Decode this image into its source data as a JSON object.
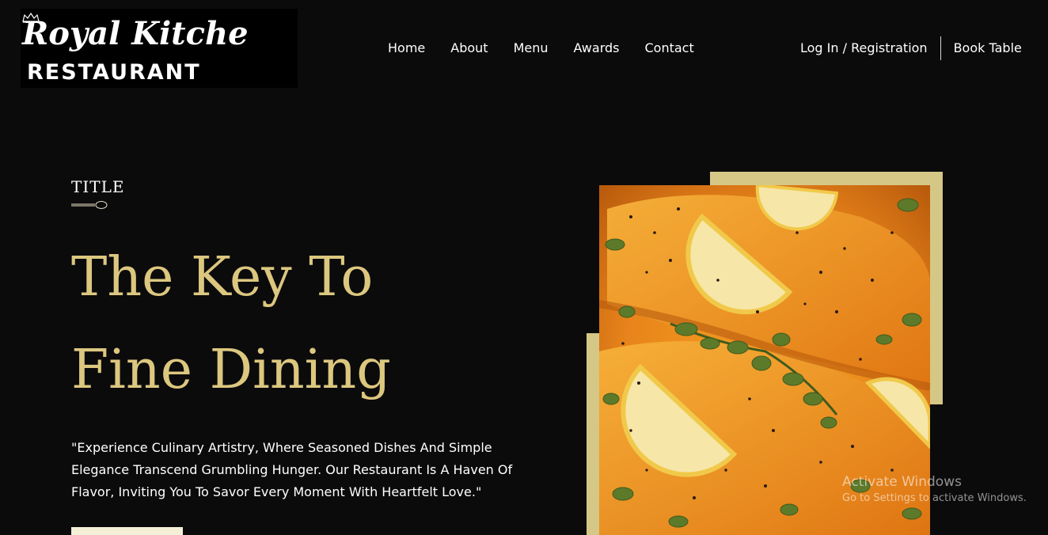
{
  "brand": {
    "line1": "Royal Kitche",
    "line2": "RESTAURANT"
  },
  "nav": {
    "items": [
      "Home",
      "About",
      "Menu",
      "Awards",
      "Contact"
    ]
  },
  "auth": {
    "login_label": "Log In / Registration",
    "book_label": "Book Table"
  },
  "hero": {
    "eyebrow": "TITLE",
    "headline_line1": "The Key To",
    "headline_line2": "Fine Dining",
    "description": "\"Experience Culinary Artistry, Where Seasoned Dishes And Simple Elegance Transcend Grumbling Hunger. Our Restaurant Is A Haven Of Flavor, Inviting You To Savor Every Moment With Heartfelt Love.\""
  },
  "watermark": {
    "line1": "Activate Windows",
    "line2": "Go to Settings to activate Windows."
  },
  "colors": {
    "background": "#0b0b0c",
    "accent_gold": "#dcc77f",
    "frame": "#d5c785",
    "food_orange": "#e8841b"
  },
  "icons": {
    "logo_crown": "crown-icon",
    "divider": "spoon-divider-icon"
  }
}
